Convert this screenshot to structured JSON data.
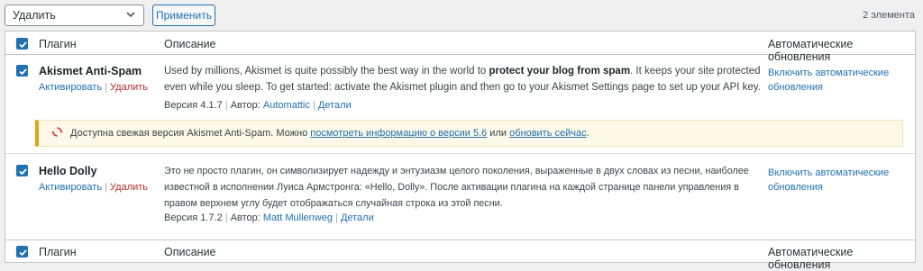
{
  "toolbar": {
    "bulk_action": "Удалить",
    "apply_label": "Применить",
    "items_count": "2 элемента"
  },
  "columns": {
    "plugin": "Плагин",
    "description": "Описание",
    "auto_updates": "Автоматические обновления"
  },
  "plugins": [
    {
      "name": "Akismet Anti-Spam",
      "activate": "Активировать",
      "separator": "|",
      "delete": "Удалить",
      "desc_pre": "Used by millions, Akismet is quite possibly the best way in the world to ",
      "desc_bold": "protect your blog from spam",
      "desc_post": ". It keeps your site protected even while you sleep. To get started: activate the Akismet plugin and then go to your Akismet Settings page to set up your API key.",
      "version": "Версия 4.1.7",
      "author_label": "Автор:",
      "author": "Automattic",
      "details": "Детали",
      "auto_update_link": "Включить автоматические обновления"
    },
    {
      "name": "Hello Dolly",
      "activate": "Активировать",
      "separator": "|",
      "delete": "Удалить",
      "desc": "Это не просто плагин, он символизирует надежду и энтузиазм целого поколения, выраженные в двух словах из песни, наиболее известной в исполнении Луиса Армстронга: «Hello, Dolly». После активации плагина на каждой странице панели управления в правом верхнем углу будет отображаться случайная строка из этой песни.",
      "version": "Версия 1.7.2",
      "author_label": "Автор:",
      "author": "Matt Mullenweg",
      "details": "Детали",
      "auto_update_link": "Включить автоматические обновления"
    }
  ],
  "update_notice": {
    "text_1": "Доступна свежая версия Akismet Anti-Spam. Можно ",
    "link_1": "посмотреть информацию о версии 5.6",
    "text_2": " или ",
    "link_2": "обновить сейчас",
    "text_3": "."
  },
  "colors": {
    "accent": "#2271b1",
    "delete": "#b32d2e",
    "notice_border": "#dba617",
    "notice_icon": "#d63638"
  }
}
